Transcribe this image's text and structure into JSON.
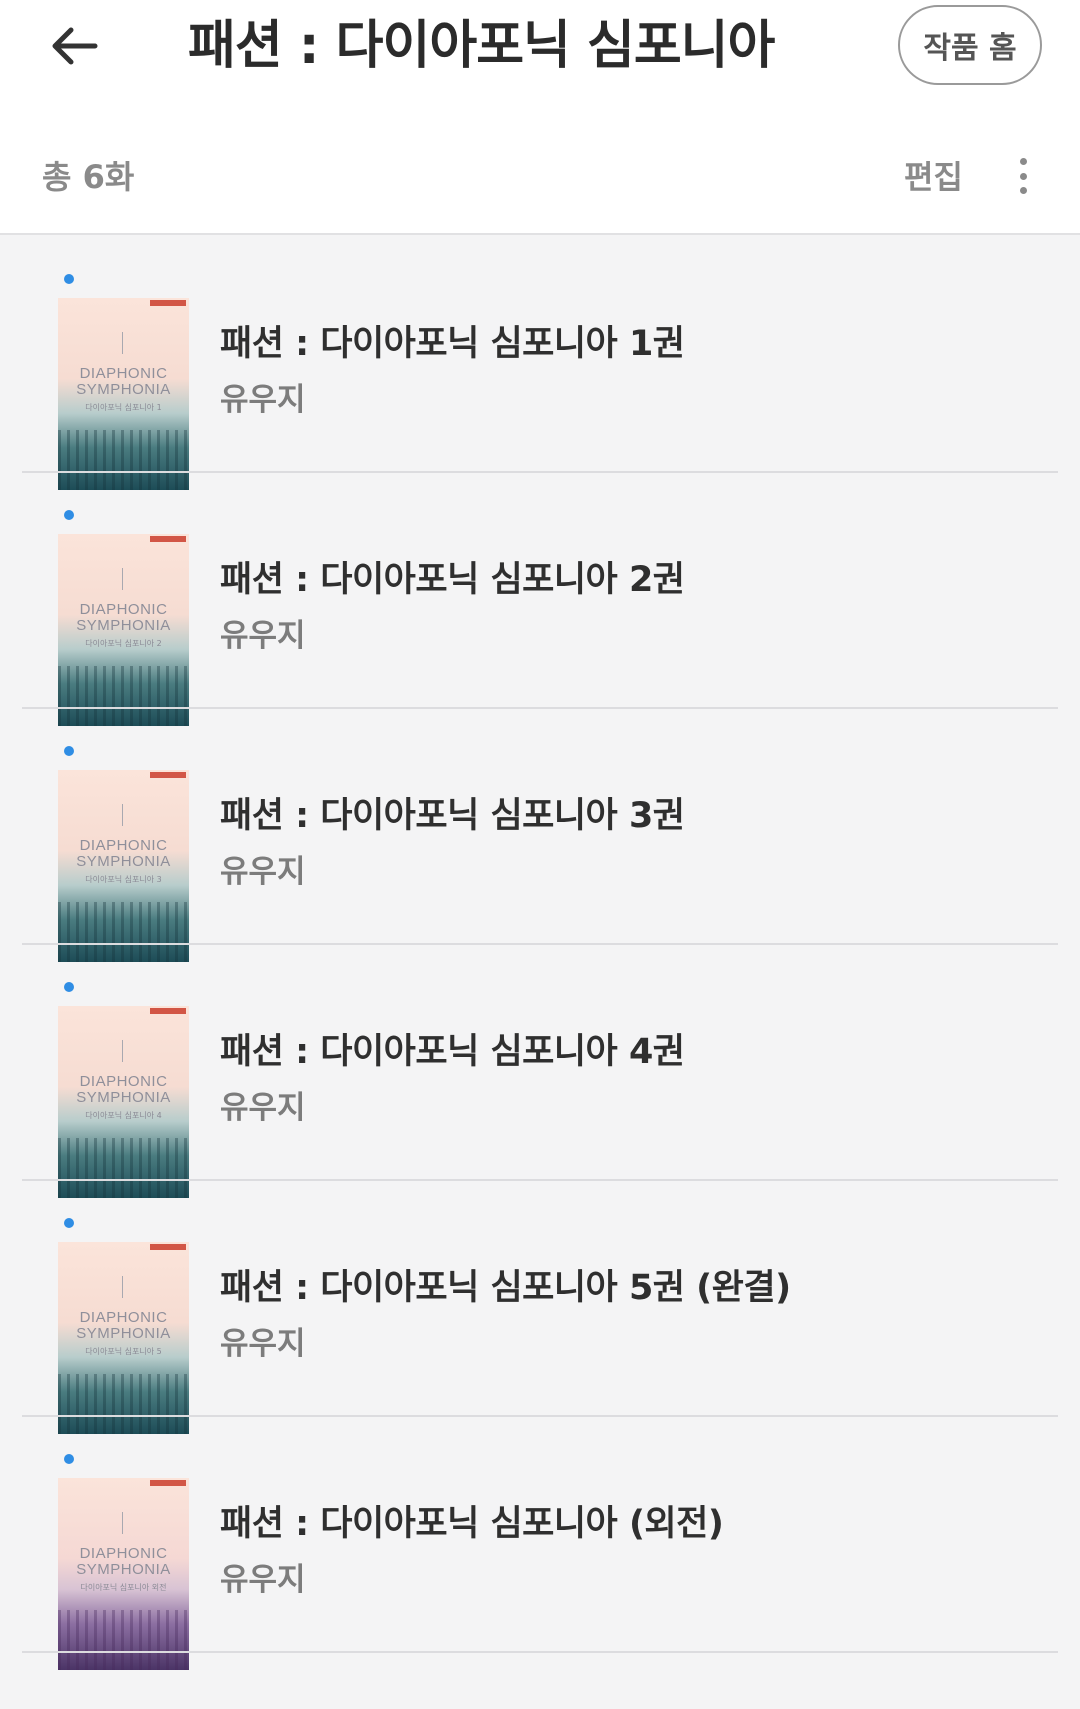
{
  "header": {
    "title": "패션 : 다이아포닉 심포니아",
    "home_button": "작품 홈",
    "back_icon": "arrow-left-icon"
  },
  "toolbar": {
    "count": "총 6화",
    "edit": "편집",
    "more_icon": "more-vertical-icon"
  },
  "colors": {
    "accent_dot": "#2f8de4",
    "text_primary": "#2f2f2f",
    "text_secondary": "#7c7c7c",
    "background": "#f4f4f5"
  },
  "items": [
    {
      "title": "패션 : 다이아포닉 심포니아 1권",
      "author": "유우지",
      "cover": {
        "line1": "DIAPHONIC",
        "line2": "SYMPHONIA",
        "sub": "다이아포닉 심포니아 1"
      }
    },
    {
      "title": "패션 : 다이아포닉 심포니아 2권",
      "author": "유우지",
      "cover": {
        "line1": "DIAPHONIC",
        "line2": "SYMPHONIA",
        "sub": "다이아포닉 심포니아 2"
      }
    },
    {
      "title": "패션 : 다이아포닉 심포니아 3권",
      "author": "유우지",
      "cover": {
        "line1": "DIAPHONIC",
        "line2": "SYMPHONIA",
        "sub": "다이아포닉 심포니아 3"
      }
    },
    {
      "title": "패션 : 다이아포닉 심포니아 4권",
      "author": "유우지",
      "cover": {
        "line1": "DIAPHONIC",
        "line2": "SYMPHONIA",
        "sub": "다이아포닉 심포니아 4"
      }
    },
    {
      "title": "패션 : 다이아포닉 심포니아 5권 (완결)",
      "author": "유우지",
      "cover": {
        "line1": "DIAPHONIC",
        "line2": "SYMPHONIA",
        "sub": "다이아포닉 심포니아 5"
      }
    },
    {
      "title": "패션 : 다이아포닉 심포니아 (외전)",
      "author": "유우지",
      "cover": {
        "line1": "DIAPHONIC",
        "line2": "SYMPHONIA",
        "sub": "다이아포닉 심포니아 외전"
      }
    }
  ]
}
